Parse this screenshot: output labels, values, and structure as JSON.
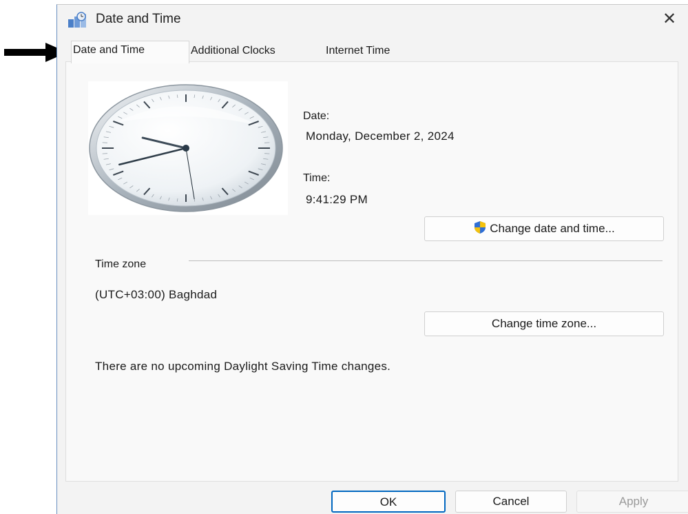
{
  "window": {
    "title": "Date and Time",
    "close_label": "✕"
  },
  "tabs": [
    {
      "label": "Date and Time",
      "active": true
    },
    {
      "label": "Additional Clocks",
      "active": false
    },
    {
      "label": "Internet Time",
      "active": false
    }
  ],
  "clock": {
    "hour": 9,
    "minute": 41,
    "second": 29
  },
  "date": {
    "label": "Date:",
    "value": "Monday, December 2, 2024"
  },
  "time": {
    "label": "Time:",
    "value": "9:41:29 PM"
  },
  "buttons": {
    "change_date_time": "Change date and time...",
    "change_time_zone": "Change time zone...",
    "ok": "OK",
    "cancel": "Cancel",
    "apply": "Apply"
  },
  "timezone": {
    "label": "Time zone",
    "value": "(UTC+03:00) Baghdad"
  },
  "dst_message": "There are no upcoming Daylight Saving Time changes.",
  "colors": {
    "accent": "#0067c0",
    "shield_blue": "#2f6fd6",
    "shield_yellow": "#f4c20d"
  }
}
